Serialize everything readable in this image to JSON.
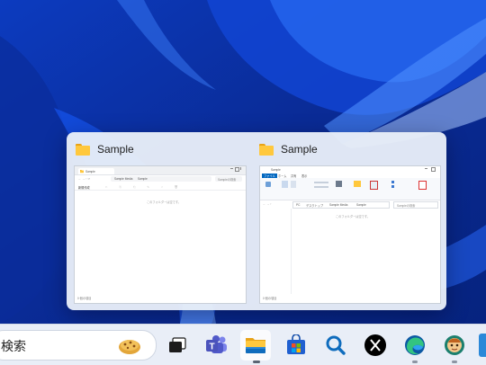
{
  "preview": {
    "windows": [
      {
        "title": "Sample",
        "thumb": {
          "path_segments": [
            "Sample Media",
            "Sample"
          ],
          "search_placeholder": "Sampleの検索",
          "new_label": "新規作成",
          "empty_text": "このフォルダーは空です。",
          "status_text": "0 個の項目"
        }
      },
      {
        "title": "Sample",
        "thumb": {
          "tabs": [
            "ファイル",
            "ホーム",
            "共有",
            "表示"
          ],
          "path_segments": [
            "PC",
            "デスクトップ",
            "Sample Media",
            "Sample"
          ],
          "search_placeholder": "Sampleの検索",
          "empty_text": "このフォルダーは空です。",
          "status_text": "0 個の項目"
        }
      }
    ]
  },
  "taskbar": {
    "search_text": "検索",
    "apps": [
      {
        "name": "task-view",
        "active": false,
        "running": false
      },
      {
        "name": "teams",
        "active": false,
        "running": false
      },
      {
        "name": "file-explorer",
        "active": true,
        "running": true
      },
      {
        "name": "microsoft-store",
        "active": false,
        "running": false
      },
      {
        "name": "search-app",
        "active": false,
        "running": false
      },
      {
        "name": "x",
        "active": false,
        "running": false
      },
      {
        "name": "edge",
        "active": false,
        "running": true
      },
      {
        "name": "edge-canary",
        "active": false,
        "running": true
      }
    ]
  },
  "colors": {
    "accent": "#0067c0",
    "folder_yellow": "#ffc83d",
    "wallpaper_base": "#0a2f9e"
  }
}
